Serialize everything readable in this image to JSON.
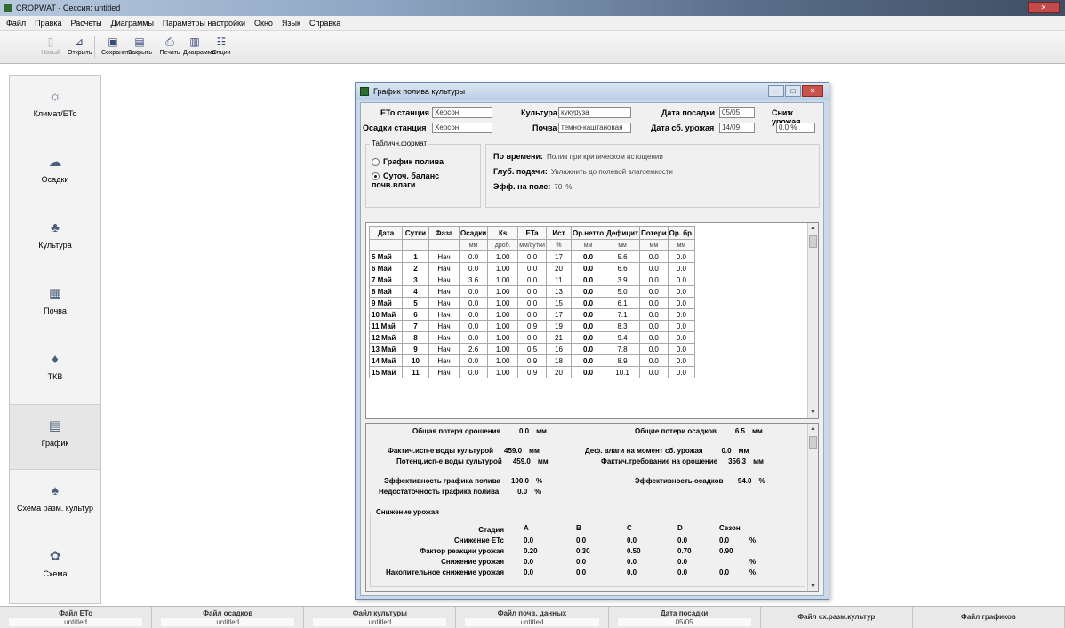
{
  "app": {
    "title": "CROPWAT - Сессия: untitled",
    "menu": [
      "Файл",
      "Правка",
      "Расчеты",
      "Диаграммы",
      "Параметры настройки",
      "Окно",
      "Язык",
      "Справка"
    ],
    "toolbar": [
      {
        "label": "Новый",
        "icon": "new-file-icon",
        "disabled": true
      },
      {
        "label": "Открыть",
        "icon": "open-folder-icon",
        "disabled": false
      },
      {
        "label": "Сохранить",
        "icon": "save-icon",
        "disabled": false
      },
      {
        "label": "Закрыть",
        "icon": "close-file-icon",
        "disabled": false
      },
      {
        "label": "Печать",
        "icon": "print-icon",
        "disabled": false
      },
      {
        "label": "Диаграмма",
        "icon": "chart-icon",
        "disabled": false
      },
      {
        "label": "Опции",
        "icon": "options-icon",
        "disabled": false
      }
    ]
  },
  "sidebar": {
    "items": [
      {
        "label": "Климат/ETo",
        "icon": "sun-icon",
        "active": false
      },
      {
        "label": "Осадки",
        "icon": "rain-cloud-icon",
        "active": false
      },
      {
        "label": "Культура",
        "icon": "plant-icon",
        "active": false
      },
      {
        "label": "Почва",
        "icon": "soil-icon",
        "active": false
      },
      {
        "label": "ТКВ",
        "icon": "water-drop-icon",
        "active": false
      },
      {
        "label": "График",
        "icon": "schedule-icon",
        "active": true
      },
      {
        "label": "Схема разм. культур",
        "icon": "crop-pattern-icon",
        "active": false
      },
      {
        "label": "Схема",
        "icon": "scheme-icon",
        "active": false
      }
    ]
  },
  "statusbar": [
    {
      "label": "Файл ETo",
      "value": "untitled"
    },
    {
      "label": "Файл осадков",
      "value": "untitled"
    },
    {
      "label": "Файл культуры",
      "value": "untitled"
    },
    {
      "label": "Файл почв. данных",
      "value": "untitled"
    },
    {
      "label": "Дата посадки",
      "value": "05/05"
    },
    {
      "label": "Файл сх.разм.культур",
      "value": ""
    },
    {
      "label": "Файл графиков",
      "value": ""
    }
  ],
  "dialog": {
    "title": "График полива культуры",
    "eto_station_label": "ETo станция",
    "eto_station_value": "Херсон",
    "rain_station_label": "Осадки станция",
    "rain_station_value": "Херсон",
    "crop_label": "Культура",
    "crop_value": "кукуруза",
    "soil_label": "Почва",
    "soil_value": "темно-каштановая",
    "planting_date_label": "Дата посадки",
    "planting_date_value": "05/05",
    "harvest_date_label": "Дата сб. урожая",
    "harvest_date_value": "14/09",
    "yield_reduction_label": "Сниж урожая",
    "yield_reduction_value": "0.0 %",
    "table_format_legend": "Табличн.формат",
    "radio_schedule": "График полива",
    "radio_balance": "Суточ. баланс почв.влаги",
    "timing_label": "По времени:",
    "timing_value": "Полив при критическом истощении",
    "depth_label": "Глуб. подачи:",
    "depth_value": "Увлажнить до полевой влагоемкости",
    "efficiency_label": "Эфф. на поле:",
    "efficiency_value": "70",
    "efficiency_unit": "%"
  },
  "grid": {
    "headers": [
      "Дата",
      "Сутки",
      "Фаза",
      "Осадки",
      "Кs",
      "ETa",
      "Ист",
      "Ор.нетто",
      "Дефицит",
      "Потери",
      "Ор. бр."
    ],
    "units": [
      "",
      "",
      "",
      "мм",
      "дроб.",
      "мм/сутки",
      "%",
      "мм",
      "мм",
      "мм",
      "мм"
    ],
    "rows": [
      [
        "5 Май",
        "1",
        "Нач",
        "0.0",
        "1.00",
        "0.0",
        "17",
        "0.0",
        "5.6",
        "0.0",
        "0.0"
      ],
      [
        "6 Май",
        "2",
        "Нач",
        "0.0",
        "1.00",
        "0.0",
        "20",
        "0.0",
        "6.6",
        "0.0",
        "0.0"
      ],
      [
        "7 Май",
        "3",
        "Нач",
        "3.6",
        "1.00",
        "0.0",
        "11",
        "0.0",
        "3.9",
        "0.0",
        "0.0"
      ],
      [
        "8 Май",
        "4",
        "Нач",
        "0.0",
        "1.00",
        "0.0",
        "13",
        "0.0",
        "5.0",
        "0.0",
        "0.0"
      ],
      [
        "9 Май",
        "5",
        "Нач",
        "0.0",
        "1.00",
        "0.0",
        "15",
        "0.0",
        "6.1",
        "0.0",
        "0.0"
      ],
      [
        "10 Май",
        "6",
        "Нач",
        "0.0",
        "1.00",
        "0.0",
        "17",
        "0.0",
        "7.1",
        "0.0",
        "0.0"
      ],
      [
        "11 Май",
        "7",
        "Нач",
        "0.0",
        "1.00",
        "0.9",
        "19",
        "0.0",
        "8.3",
        "0.0",
        "0.0"
      ],
      [
        "12 Май",
        "8",
        "Нач",
        "0.0",
        "1.00",
        "0.0",
        "21",
        "0.0",
        "9.4",
        "0.0",
        "0.0"
      ],
      [
        "13 Май",
        "9",
        "Нач",
        "2.6",
        "1.00",
        "0.5",
        "16",
        "0.0",
        "7.8",
        "0.0",
        "0.0"
      ],
      [
        "14 Май",
        "10",
        "Нач",
        "0.0",
        "1.00",
        "0.9",
        "18",
        "0.0",
        "8.9",
        "0.0",
        "0.0"
      ],
      [
        "15 Май",
        "11",
        "Нач",
        "0.0",
        "1.00",
        "0.9",
        "20",
        "0.0",
        "10.1",
        "0.0",
        "0.0"
      ]
    ]
  },
  "summary": {
    "total_gross_label": "Общая потеря орошения",
    "total_gross_value": "0.0",
    "total_gross_unit": "мм",
    "total_rain_loss_label": "Общие потери осадков",
    "total_rain_loss_value": "6.5",
    "total_rain_loss_unit": "мм",
    "actual_water_label": "Фактич.исп-е воды культурой",
    "actual_water_value": "459.0",
    "actual_water_unit": "мм",
    "moist_deficit_label": "Деф. влаги на момент сб. урожая",
    "moist_deficit_value": "0.0",
    "moist_deficit_unit": "мм",
    "potential_water_label": "Потенц.исп-е воды культурой",
    "potential_water_value": "459.0",
    "potential_water_unit": "мм",
    "actual_irr_req_label": "Фактич.требование на орошение",
    "actual_irr_req_value": "356.3",
    "actual_irr_req_unit": "мм",
    "sched_eff_label": "Эффективность графика полива",
    "sched_eff_value": "100.0",
    "sched_eff_unit": "%",
    "rain_eff_label": "Эффективность осадков",
    "rain_eff_value": "94.0",
    "rain_eff_unit": "%",
    "sched_def_label": "Недостаточность графика полива",
    "sched_def_value": "0.0",
    "sched_def_unit": "%"
  },
  "yield": {
    "legend": "Снижение урожая",
    "stages_label": "Стадия",
    "stages": [
      "A",
      "B",
      "C",
      "D",
      "Сезон"
    ],
    "rows": [
      {
        "label": "Снижение ETc",
        "values": [
          "0.0",
          "0.0",
          "0.0",
          "0.0",
          "0.0"
        ],
        "unit": "%"
      },
      {
        "label": "Фактор реакции урожая",
        "values": [
          "0.20",
          "0.30",
          "0.50",
          "0.70",
          "0.90"
        ],
        "unit": ""
      },
      {
        "label": "Снижение урожая",
        "values": [
          "0.0",
          "0.0",
          "0.0",
          "0.0",
          ""
        ],
        "unit": "%"
      },
      {
        "label": "Накопительное снижение урожая",
        "values": [
          "0.0",
          "0.0",
          "0.0",
          "0.0",
          "0.0"
        ],
        "unit": "%"
      }
    ]
  }
}
